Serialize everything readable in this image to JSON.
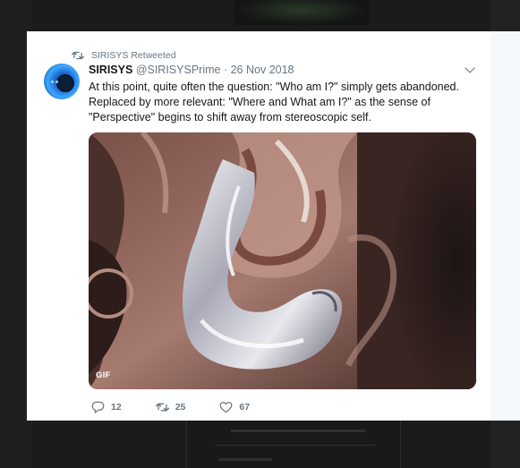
{
  "retweet_banner": {
    "label": "SIRISYS Retweeted"
  },
  "tweet": {
    "name": "SIRISYS",
    "handle": "@SIRISYSPrime",
    "separator": "·",
    "date": "26 Nov 2018",
    "text": "At this point, quite often the question: \"Who am I?\" simply gets abandoned. Replaced by more relevant: \"Where and What am I?\" as the sense of \"Perspective\" begins to shift away from stereoscopic self.",
    "media_badge": "GIF",
    "reply_count": "12",
    "retweet_count": "25",
    "like_count": "67"
  },
  "icons": {
    "retweet_banner_icon": "retweet-icon",
    "caret": "chevron-down-icon",
    "reply": "reply-icon",
    "retweet": "retweet-icon",
    "like": "heart-icon"
  },
  "colors": {
    "secondary_text": "#657786",
    "primary_text": "#14171a",
    "card_bg": "#ffffff",
    "backdrop": "#1b1b1b"
  }
}
